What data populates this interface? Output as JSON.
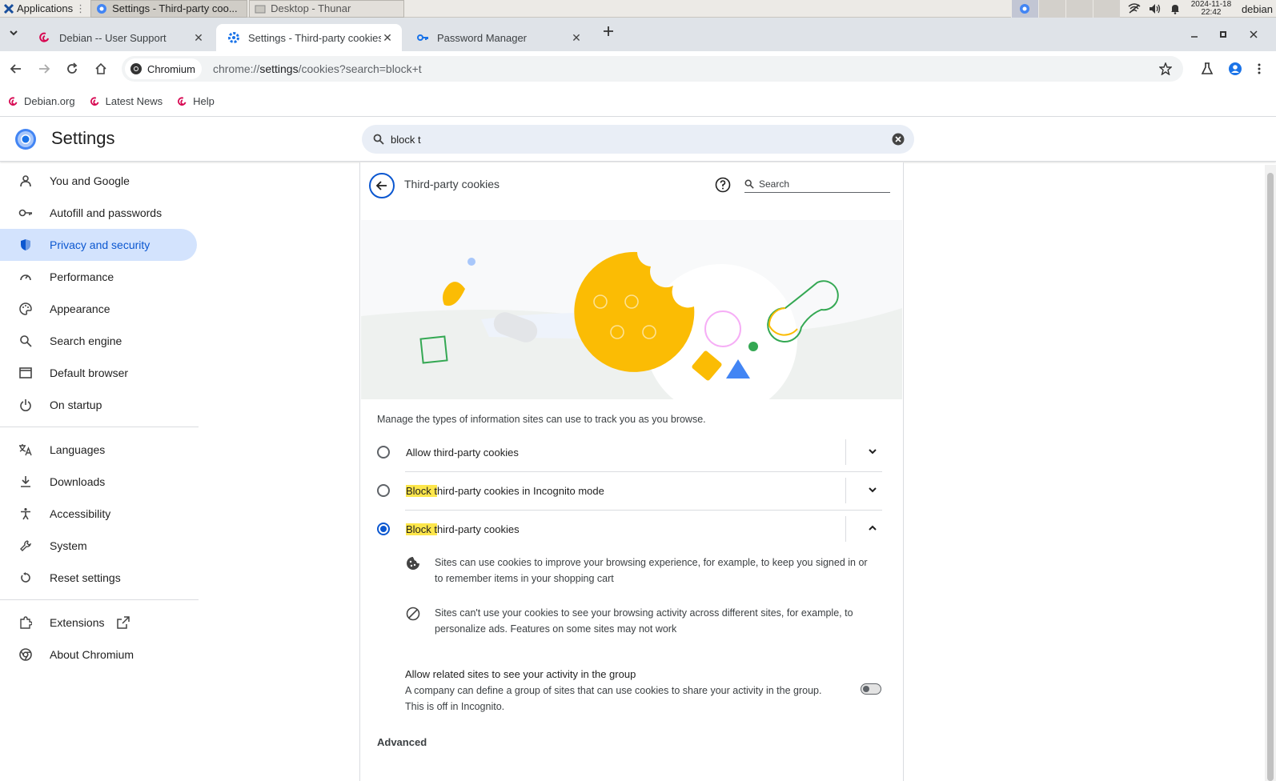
{
  "taskbar": {
    "applications_label": "Applications",
    "windows": [
      {
        "title": "Settings - Third-party coo..."
      },
      {
        "title": "Desktop - Thunar"
      }
    ],
    "clock_date": "2024-11-18",
    "clock_time": "22:42",
    "user": "debian"
  },
  "tabs": [
    {
      "title": "Debian -- User Support",
      "icon": "debian-swirl-icon"
    },
    {
      "title": "Settings - Third-party cookies",
      "icon": "settings-gear-icon"
    },
    {
      "title": "Password Manager",
      "icon": "key-icon"
    }
  ],
  "toolbar": {
    "chip_label": "Chromium",
    "url_scheme": "chrome://",
    "url_host": "settings",
    "url_path": "/cookies?search=block+t"
  },
  "bookmarks": [
    {
      "label": "Debian.org"
    },
    {
      "label": "Latest News"
    },
    {
      "label": "Help"
    }
  ],
  "settings": {
    "title": "Settings",
    "search_query": "block t"
  },
  "sidebar": {
    "items": [
      {
        "label": "You and Google",
        "icon": "person-icon"
      },
      {
        "label": "Autofill and passwords",
        "icon": "key-icon"
      },
      {
        "label": "Privacy and security",
        "icon": "shield-icon"
      },
      {
        "label": "Performance",
        "icon": "speedometer-icon"
      },
      {
        "label": "Appearance",
        "icon": "palette-icon"
      },
      {
        "label": "Search engine",
        "icon": "search-icon"
      },
      {
        "label": "Default browser",
        "icon": "browser-window-icon"
      },
      {
        "label": "On startup",
        "icon": "power-icon"
      },
      {
        "label": "Languages",
        "icon": "translate-icon"
      },
      {
        "label": "Downloads",
        "icon": "download-icon"
      },
      {
        "label": "Accessibility",
        "icon": "accessibility-icon"
      },
      {
        "label": "System",
        "icon": "wrench-icon"
      },
      {
        "label": "Reset settings",
        "icon": "reset-icon"
      },
      {
        "label": "Extensions",
        "icon": "puzzle-icon"
      },
      {
        "label": "About Chromium",
        "icon": "chromium-icon"
      }
    ]
  },
  "page": {
    "title": "Third-party cookies",
    "sub_search_placeholder": "Search",
    "intro": "Manage the types of information sites can use to track you as you browse.",
    "options": [
      {
        "prefix": "",
        "highlight": "",
        "rest": "Allow third-party cookies",
        "selected": false
      },
      {
        "prefix": "",
        "highlight": "Block t",
        "rest": "hird-party cookies in Incognito mode",
        "selected": false
      },
      {
        "prefix": "",
        "highlight": "Block t",
        "rest": "hird-party cookies",
        "selected": true
      }
    ],
    "details": [
      {
        "icon": "cookie-icon",
        "text": "Sites can use cookies to improve your browsing experience, for example, to keep you signed in or to remember items in your shopping cart"
      },
      {
        "icon": "block-icon",
        "text": "Sites can't use your cookies to see your browsing activity across different sites, for example, to personalize ads. Features on some sites may not work"
      }
    ],
    "related_title": "Allow related sites to see your activity in the group",
    "related_desc": "A company can define a group of sites that can use cookies to share your activity in the group. This is off in Incognito.",
    "related_enabled": false,
    "advanced": "Advanced"
  },
  "colors": {
    "accent": "#0b57d0",
    "highlight": "#fde64b",
    "cookie": "#fbbc04"
  }
}
